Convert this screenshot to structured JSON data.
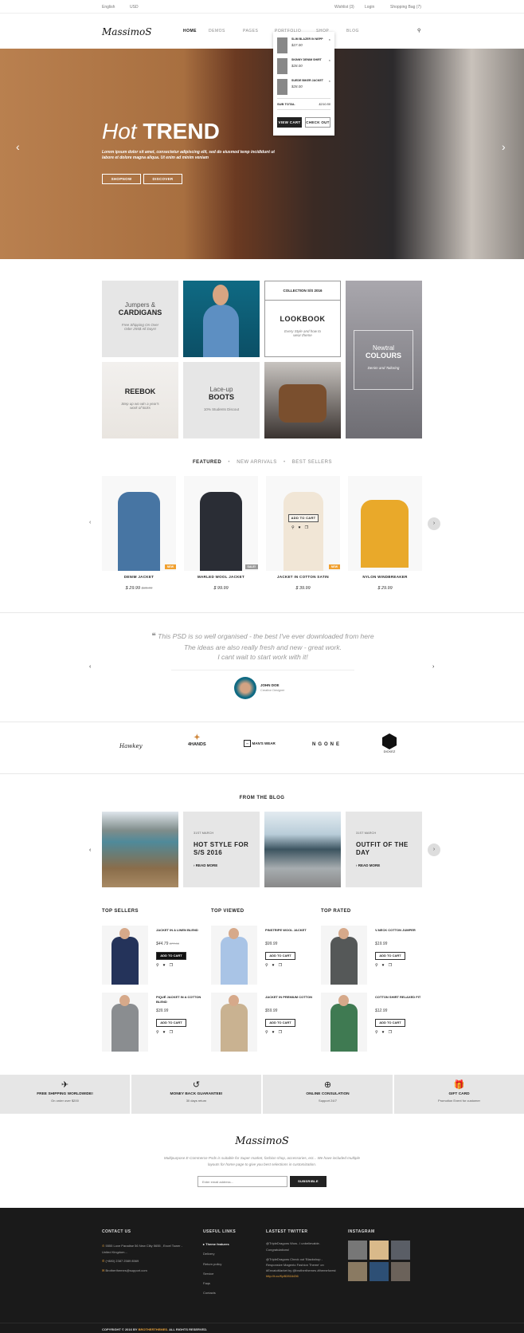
{
  "topbar": {
    "language": "English",
    "currency": "USD",
    "wishlist": "Wishlist (3)",
    "login": "Login",
    "bag": "Shopping Bag (7)"
  },
  "header": {
    "logo": "MassimoS",
    "nav": [
      "HOME",
      "DEMOS",
      "PAGES",
      "PORTFOLIO",
      "SHOP",
      "BLOG"
    ]
  },
  "cart": {
    "items": [
      {
        "name": "SLIM BLAZER IN NEPP",
        "price": "$27.00"
      },
      {
        "name": "SKINNY DENIM SHIRT",
        "price": "$28.00"
      },
      {
        "name": "SUEDE BIKER JACKET",
        "price": "$28.00"
      }
    ],
    "subtotal_label": "SUB TOTAL",
    "subtotal": "$210.50",
    "view_cart": "VIEW CART",
    "checkout": "CHECK OUT"
  },
  "hero": {
    "title_light": "Hot",
    "title_bold": "TREND",
    "text": "Lorem ipsum dolor sit amet, consectetur adipiscing elit, sed do eiusmod temp incididunt ut labore et dolore magna aliqua. Ut enim ad minim veniam",
    "btn1": "SHOPNOW",
    "btn2": "DISCOVER"
  },
  "grid": {
    "jumpers_light": "Jumpers &",
    "jumpers_bold": "CARDIGANS",
    "jumpers_sub": "Free Shipping On Over Oder 255$ All Days!",
    "collection": "COLLECTION S/S 2016",
    "lookbook": "LOOKBOOK",
    "lookbook_sub": "Every Style and how to wear theme",
    "neutral_light": "Newtral",
    "neutral_bold": "COLOURS",
    "neutral_sub": "Denim and Tailoring",
    "reebok": "REEBOK",
    "reebok_sub": "Step up wo win a year's work of kicks",
    "boots_light": "Lace-up",
    "boots_bold": "BOOTS",
    "boots_sub": "10% Students Discout"
  },
  "tabs": [
    "FEATURED",
    "NEW ARRIVALS",
    "BEST SELLERS"
  ],
  "products": [
    {
      "name": "DENIM JACKET",
      "price": "$ 29.99",
      "old": "$39.99",
      "badge": "NEW"
    },
    {
      "name": "MARLED WOOL JACKET",
      "price": "$ 99.99",
      "badge": "SALE!"
    },
    {
      "name": "JACKET IN COTTON SATIN",
      "price": "$ 39.99",
      "badge": "NEW"
    },
    {
      "name": "NYLON WINDBREAKER",
      "price": "$ 29.99"
    }
  ],
  "product_hover": {
    "add_to_cart": "ADD TO CART"
  },
  "testimonial": {
    "lines": [
      "This PSD is so well organised - the best I've ever downloaded from here",
      "The ideas are also really fresh and new - great work.",
      "I cant wait to start work with it!"
    ],
    "name": "JOHN DOE",
    "role": "Creative Designer"
  },
  "brands": [
    "Hawkey",
    "4HANDS",
    "MAN'S WEAR",
    "NGONE",
    "DICKEZ"
  ],
  "blog": {
    "title": "FROM THE BLOG",
    "posts": [
      {
        "date": "31ST MARCH",
        "title": "HOT STYLE FOR S/S 2016",
        "more": "READ MORE"
      },
      {
        "date": "31ST MARCH",
        "title": "OUTFIT OF THE DAY",
        "more": "READ MORE"
      }
    ]
  },
  "lists": [
    {
      "title": "TOP SELLERS",
      "items": [
        {
          "name": "JACKET IN A LINEN BLEND",
          "price": "$44.79",
          "old": "$77.00"
        },
        {
          "name": "PIQUÉ JACKET IN A COTTON BLEND",
          "price": "$39.99"
        }
      ]
    },
    {
      "title": "TOP VIEWED",
      "items": [
        {
          "name": "PINSTRIPE WOOL JACKET",
          "price": "$99.99"
        },
        {
          "name": "JACKET IN PREMIUM COTTON",
          "price": "$59.99"
        }
      ]
    },
    {
      "title": "TOP RATED",
      "items": [
        {
          "name": "V-NECK COTTON JUMPER",
          "price": "$19.99"
        },
        {
          "name": "COTTON SHIRT RELAXED FIT",
          "price": "$12.99"
        }
      ]
    }
  ],
  "features": [
    {
      "icon": "plane-icon",
      "title": "FREE SHIPPING WORLDWIDE!",
      "sub": "On order over $200"
    },
    {
      "icon": "money-back-icon",
      "title": "MONEY BACK GUARANTEE!",
      "sub": "30 days return"
    },
    {
      "icon": "lifebuoy-icon",
      "title": "ONLINE CONSULATION",
      "sub": "Support 24/7"
    },
    {
      "icon": "gift-icon",
      "title": "GIFT CARD",
      "sub": "Promotion Event for customer"
    }
  ],
  "newsletter": {
    "logo": "MassimoS",
    "text": "Multipurpose E-Commerce Psds is suitable for Super market, fashion shop, accessories, ect... We have included multiple layouts for home page to give you best selections in customization.",
    "placeholder": "Enter email address...",
    "button": "SUBSRIBLE"
  },
  "footer": {
    "contact_title": "CONTACT US",
    "address": "5555 Love Paradise 56 New Clity 5655 , Excel Tower - United Kingdom...",
    "phone": "(+880) 2387 2589 8569",
    "email": "Brotherthemes@support.com",
    "links_title": "USEFUL LINKS",
    "links": [
      "Theme features",
      "Delivery",
      "Return policy",
      "Service",
      "Faqs",
      "Contacts"
    ],
    "twitter_title": "LASTEST TWITTER",
    "tweet1": "@TripleDragons Wow.. I unbelievable. Congratulations!",
    "tweet2": "@TripleDragons Check out 'Blackshop - Responsive Magento Fashion Theme' on #EnvatoMarket by @brotherthemes #themeforest",
    "tweet2_link": "http://t.co/KpB2816436",
    "instagram_title": "INSTAGRAM",
    "copyright": "COPYRIGHT © 2016 BY",
    "brand": "BROTHERTHEMES.",
    "rights": "ALL RIGHTS RESERVED.",
    "accent": "#e8a13a"
  }
}
